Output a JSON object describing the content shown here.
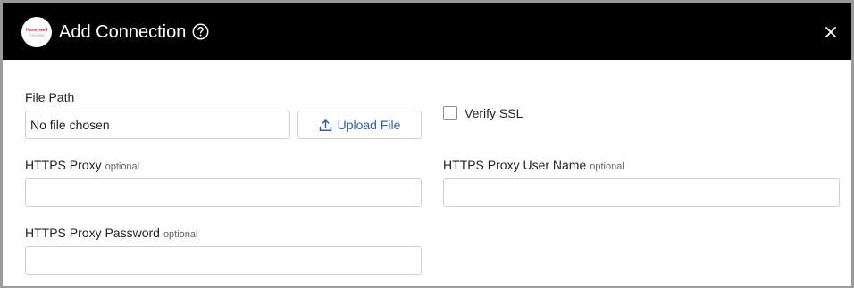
{
  "dialog": {
    "title": "Add Connection",
    "logo_brand": "Honeywell",
    "logo_sub": "TXCSIS0",
    "help_icon": "help-circle-icon",
    "close_icon": "close-icon"
  },
  "form": {
    "file_path_label": "File Path",
    "file_path_value": "No file chosen",
    "upload_label": "Upload File",
    "upload_icon": "upload-icon",
    "verify_ssl_label": "Verify SSL",
    "verify_ssl_checked": false,
    "proxy_label": "HTTPS Proxy",
    "proxy_optional": "optional",
    "proxy_value": "",
    "proxy_user_label": "HTTPS Proxy User Name",
    "proxy_user_optional": "optional",
    "proxy_user_value": "",
    "proxy_password_label": "HTTPS Proxy Password",
    "proxy_password_optional": "optional",
    "proxy_password_value": ""
  },
  "colors": {
    "header_bg": "#000000",
    "link_blue": "#2f5fa8",
    "logo_red": "#d2202f"
  }
}
